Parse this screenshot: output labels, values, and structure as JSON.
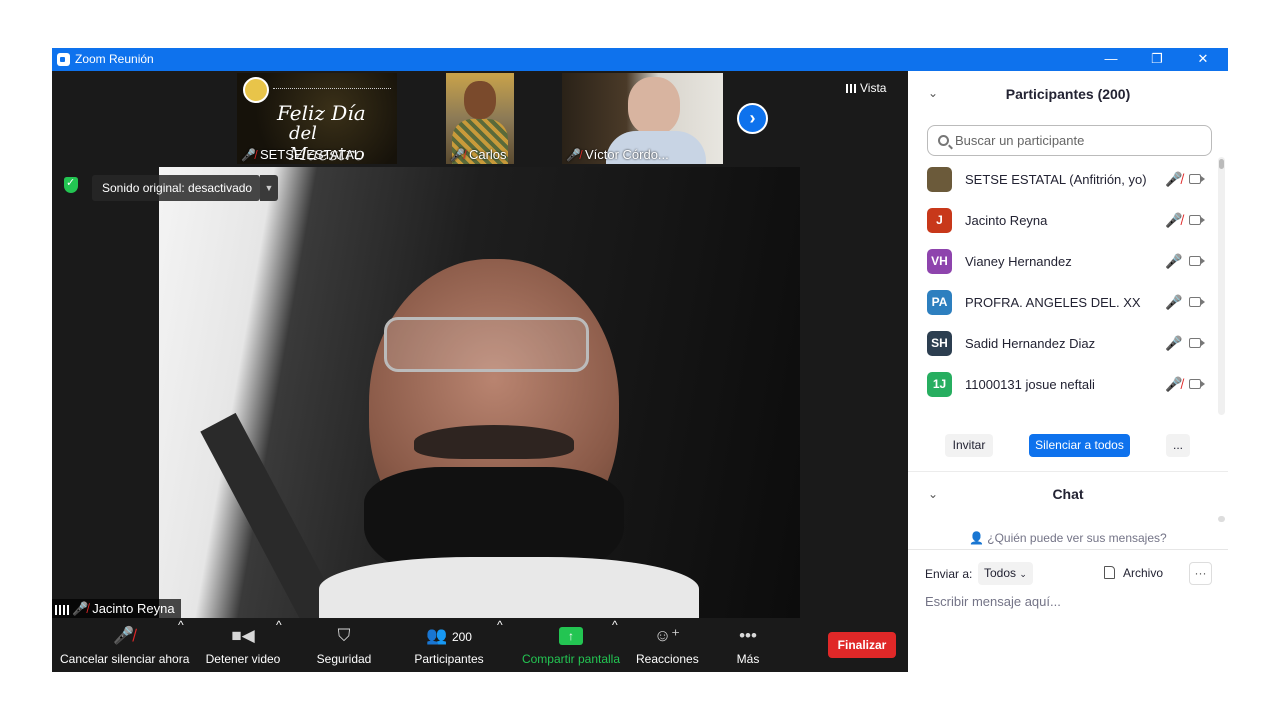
{
  "window": {
    "title": "Zoom Reunión",
    "min_icon": "minimize-icon",
    "max_icon": "maximize-icon",
    "close_icon": "close-icon"
  },
  "thumbnails": [
    {
      "name": "SETSE ESTATAL",
      "muted": true,
      "text_line1": "Feliz Día",
      "text_line2": "del Maestro"
    },
    {
      "name": "Carlos",
      "muted": true
    },
    {
      "name": "Víctor Córdo...",
      "muted": true
    }
  ],
  "view_label": "Vista",
  "original_sound": "Sonido original: desactivado",
  "speaker": {
    "name": "Jacinto Reyna",
    "muted": true
  },
  "toolbar": {
    "mute_label": "Cancelar silenciar ahora",
    "video_label": "Detener video",
    "security_label": "Seguridad",
    "participants_label": "Participantes",
    "participants_count": "200",
    "share_label": "Compartir pantalla",
    "reactions_label": "Reacciones",
    "more_label": "Más",
    "end_label": "Finalizar",
    "share_color": "#23c552",
    "end_color": "#e02828"
  },
  "panel": {
    "title": "Participantes (200)",
    "search_placeholder": "Buscar un participante",
    "participants": [
      {
        "initials": "",
        "name": "SETSE ESTATAL (Anfitrión, yo)",
        "color": "#6b5a3a",
        "mic": "muted"
      },
      {
        "initials": "J",
        "name": "Jacinto Reyna",
        "color": "#c8381a",
        "mic": "muted"
      },
      {
        "initials": "VH",
        "name": "Vianey Hernandez",
        "color": "#8e44ad",
        "mic": "on"
      },
      {
        "initials": "PA",
        "name": "PROFRA. ANGELES DEL. XX",
        "color": "#2d7fbf",
        "mic": "on"
      },
      {
        "initials": "SH",
        "name": "Sadid Hernandez Diaz",
        "color": "#2c3e50",
        "mic": "on"
      },
      {
        "initials": "1J",
        "name": "11000131 josue neftali",
        "color": "#27ae60",
        "mic": "muted"
      }
    ],
    "invite_label": "Invitar",
    "mute_all_label": "Silenciar a todos",
    "more_label": "...",
    "accent": "#0e72ed"
  },
  "chat": {
    "title": "Chat",
    "who_can_see": "¿Quién puede ver sus mensajes?",
    "send_to_label": "Enviar a:",
    "send_to_value": "Todos",
    "file_label": "Archivo",
    "more_label": "···",
    "input_placeholder": "Escribir mensaje aquí..."
  }
}
